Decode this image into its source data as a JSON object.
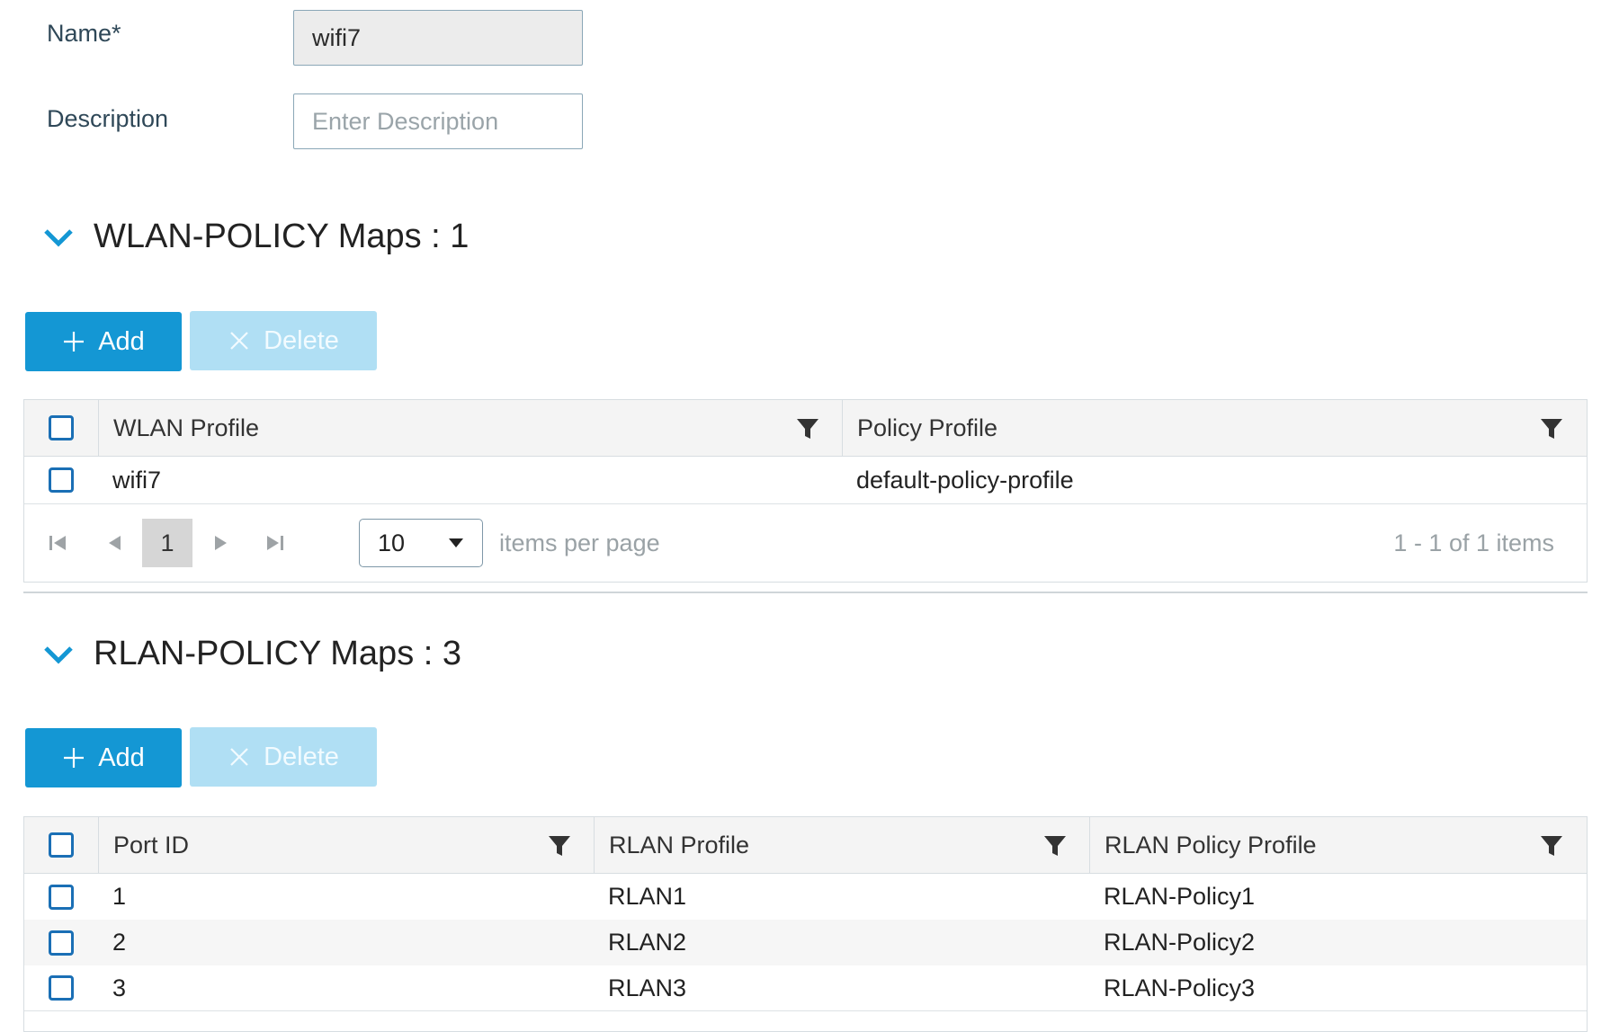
{
  "form": {
    "name_label": "Name*",
    "name_value": "wifi7",
    "description_label": "Description",
    "description_placeholder": "Enter Description"
  },
  "wlan_section": {
    "title": "WLAN-POLICY Maps : 1",
    "add_label": "Add",
    "delete_label": "Delete",
    "columns": [
      "WLAN Profile",
      "Policy Profile"
    ],
    "rows": [
      {
        "wlan_profile": "wifi7",
        "policy_profile": "default-policy-profile"
      }
    ],
    "pager": {
      "current_page": "1",
      "page_size": "10",
      "items_per_page_label": "items per page",
      "summary": "1 - 1 of 1 items"
    }
  },
  "rlan_section": {
    "title": "RLAN-POLICY Maps : 3",
    "add_label": "Add",
    "delete_label": "Delete",
    "columns": [
      "Port ID",
      "RLAN Profile",
      "RLAN Policy Profile"
    ],
    "rows": [
      {
        "port_id": "1",
        "rlan_profile": "RLAN1",
        "rlan_policy_profile": "RLAN-Policy1"
      },
      {
        "port_id": "2",
        "rlan_profile": "RLAN2",
        "rlan_policy_profile": "RLAN-Policy2"
      },
      {
        "port_id": "3",
        "rlan_profile": "RLAN3",
        "rlan_policy_profile": "RLAN-Policy3"
      }
    ]
  },
  "colors": {
    "primary": "#1497d4",
    "primary_disabled": "#b0dff4",
    "checkbox_border": "#1a6fb5",
    "chevron": "#1497d4"
  },
  "icons": [
    "chevron-down-icon",
    "plus-icon",
    "close-icon",
    "filter-icon",
    "first-page-icon",
    "prev-page-icon",
    "next-page-icon",
    "last-page-icon",
    "dropdown-caret-icon"
  ]
}
